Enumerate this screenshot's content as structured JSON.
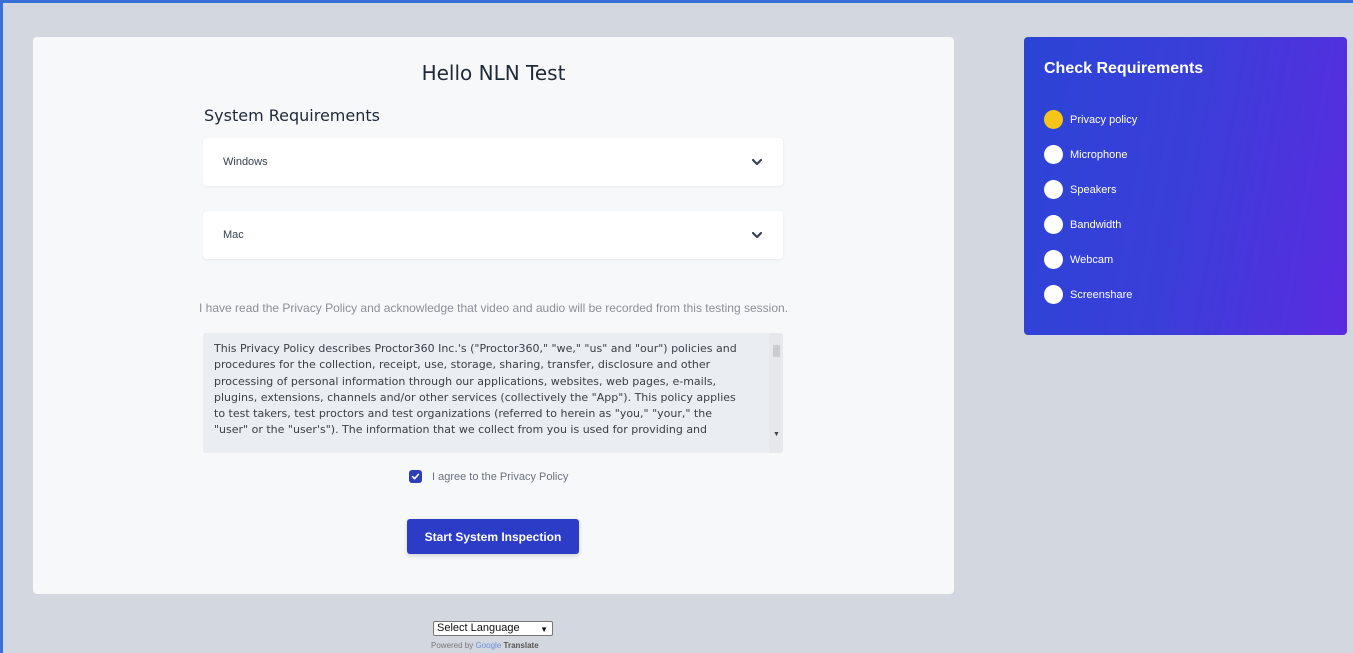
{
  "main": {
    "title": "Hello NLN Test",
    "section_title": "System Requirements",
    "accordions": [
      {
        "label": "Windows"
      },
      {
        "label": "Mac"
      }
    ],
    "acknowledge_text": "I have read the Privacy Policy and acknowledge that video and audio will be recorded from this testing session.",
    "policy_lines": [
      "This Privacy Policy describes Proctor360 Inc.'s (\"Proctor360,\" \"we,\" \"us\" and \"our\") policies and",
      "procedures for the collection, receipt, use, storage, sharing, transfer, disclosure and other",
      "processing of personal information through our applications, websites, web pages, e-mails,",
      "plugins, extensions, channels and/or other services (collectively the \"App\"). This policy applies",
      "to test takers, test proctors and test organizations (referred to herein as \"you,\" \"your,\" the",
      "\"user\" or the \"user's\"). The information that we collect from you is used for providing and"
    ],
    "agree_label": "I agree to the Privacy Policy",
    "agree_checked": true,
    "start_button": "Start System Inspection"
  },
  "requirements": {
    "title": "Check Requirements",
    "items": [
      {
        "label": "Privacy policy",
        "status": "active"
      },
      {
        "label": "Microphone",
        "status": "pending"
      },
      {
        "label": "Speakers",
        "status": "pending"
      },
      {
        "label": "Bandwidth",
        "status": "pending"
      },
      {
        "label": "Webcam",
        "status": "pending"
      },
      {
        "label": "Screenshare",
        "status": "pending"
      }
    ],
    "active_color": "#f5c518",
    "pending_color": "#ffffff"
  },
  "footer": {
    "language_select": "Select Language",
    "powered_by": "Powered by",
    "google": "Google",
    "translate": "Translate"
  },
  "colors": {
    "accent": "#2c3cc7",
    "background": "#d3d7df"
  }
}
